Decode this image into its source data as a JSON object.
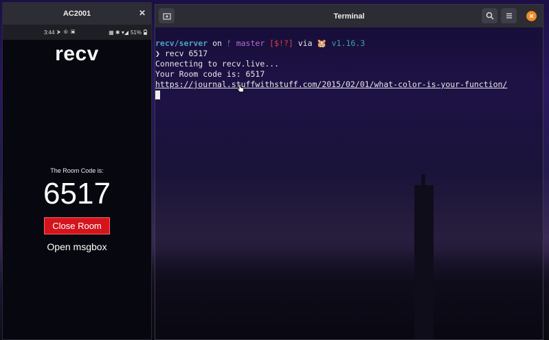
{
  "phone": {
    "window_title": "AC2001",
    "close_glyph": "✕",
    "status": {
      "time": "3:44",
      "battery": "51%",
      "icons": "⮞ ⊕ ▣",
      "right_icons": "▦ ✱ ▾◢"
    },
    "app_title": "recv",
    "room_label": "The Room Code is:",
    "room_code": "6517",
    "close_room_label": "Close Room",
    "open_msgbox_label": "Open msgbox"
  },
  "terminal": {
    "title": "Terminal",
    "prompt": {
      "path": "recv/server",
      "on": " on ",
      "branch": "ᚠ master",
      "status": " [$!?]",
      "via": " via ",
      "emoji": "🐹",
      "version": " v1.16.3"
    },
    "command_prefix": "❯ ",
    "command": "recv 6517",
    "output": [
      "Connecting to recv.live...",
      "Your Room code is: 6517"
    ],
    "link": "https://journal.stuffwithstuff.com/2015/02/01/what-color-is-your-function/"
  }
}
